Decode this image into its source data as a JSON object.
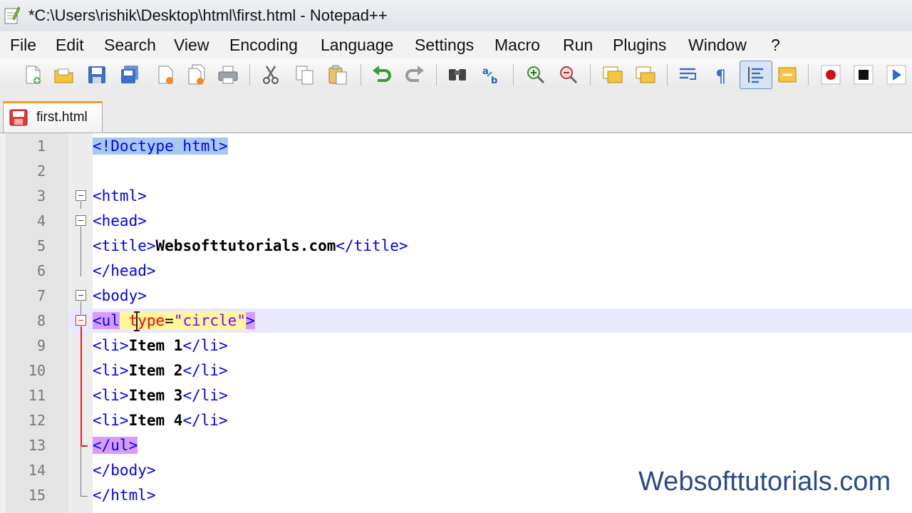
{
  "window": {
    "title": "*C:\\Users\\rishik\\Desktop\\html\\first.html - Notepad++",
    "icon": "notepad-app-icon"
  },
  "menu": [
    "File",
    "Edit",
    "Search",
    "View",
    "Encoding",
    "Language",
    "Settings",
    "Macro",
    "Run",
    "Plugins",
    "Window",
    "?"
  ],
  "toolbar": {
    "icons": [
      "new-file-icon",
      "open-file-icon",
      "save-icon",
      "save-all-icon",
      "close-icon",
      "close-all-icon",
      "print-icon",
      "cut-icon",
      "copy-icon",
      "paste-icon",
      "undo-icon",
      "redo-icon",
      "find-icon",
      "replace-icon",
      "zoom-in-icon",
      "zoom-out-icon",
      "sync-vertical-icon",
      "sync-horizontal-icon",
      "word-wrap-icon",
      "show-all-chars-icon",
      "indent-guide-icon",
      "user-lang-icon",
      "record-macro-icon",
      "stop-record-icon",
      "play-macro-icon"
    ]
  },
  "tab": {
    "label": "first.html",
    "modified": true
  },
  "editor": {
    "current_line": 8,
    "lines": [
      {
        "n": "1",
        "seg": [
          "<!Doctype html>"
        ]
      },
      {
        "n": "2",
        "seg": [
          ""
        ]
      },
      {
        "n": "3",
        "seg": [
          "<html>"
        ]
      },
      {
        "n": "4",
        "seg": [
          "<head>"
        ]
      },
      {
        "n": "5",
        "seg": [
          "<title>",
          "Websofttutorials.com",
          "</title>"
        ]
      },
      {
        "n": "6",
        "seg": [
          "</head>"
        ]
      },
      {
        "n": "7",
        "seg": [
          "<body>"
        ]
      },
      {
        "n": "8",
        "seg": [
          "<ul",
          " ",
          "type",
          "=",
          "\"circle\"",
          ">"
        ]
      },
      {
        "n": "9",
        "seg": [
          "<li>",
          "Item 1",
          "</li>"
        ]
      },
      {
        "n": "10",
        "seg": [
          "<li>",
          "Item 2",
          "</li>"
        ]
      },
      {
        "n": "11",
        "seg": [
          "<li>",
          "Item 3",
          "</li>"
        ]
      },
      {
        "n": "12",
        "seg": [
          "<li>",
          "Item 4",
          "</li>"
        ]
      },
      {
        "n": "13",
        "seg": [
          "</ul>"
        ]
      },
      {
        "n": "14",
        "seg": [
          "</body>"
        ]
      },
      {
        "n": "15",
        "seg": [
          "</html>"
        ]
      }
    ]
  },
  "watermark": "Websofttutorials.com",
  "colors": {
    "tag": "#0000ff",
    "attribute": "#ff0000",
    "string": "#8000ff",
    "text": "#000000",
    "brace_highlight": "#a8c8f0",
    "tag_match_highlight": "#d89cf8",
    "fold_active": "#e02020",
    "watermark": "#2b4a8a"
  }
}
